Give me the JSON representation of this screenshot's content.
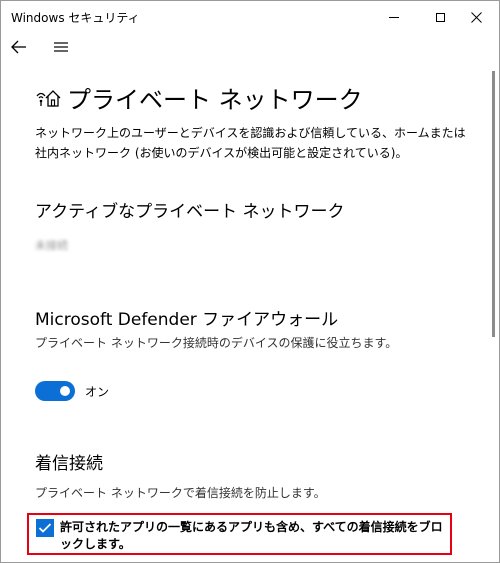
{
  "window": {
    "title": "Windows セキュリティ"
  },
  "page": {
    "title": "プライベート ネットワーク",
    "description": "ネットワーク上のユーザーとデバイスを認識および信頼している、ホームまたは社内ネットワーク (お使いのデバイスが検出可能と設定されている)。"
  },
  "active_networks": {
    "heading": "アクティブなプライベート ネットワーク",
    "network_name": "未接続"
  },
  "firewall": {
    "heading": "Microsoft Defender ファイアウォール",
    "description": "プライベート ネットワーク接続時のデバイスの保護に役立ちます。",
    "toggle_label": "オン",
    "toggle_on": true
  },
  "incoming": {
    "heading": "着信接続",
    "description": "プライベート ネットワークで着信接続を防止します。",
    "checkbox_label": "許可されたアプリの一覧にあるアプリも含め、すべての着信接続をブロックします。",
    "checkbox_checked": true
  },
  "colors": {
    "accent": "#0b6fd6",
    "highlight_border": "#e60012"
  },
  "icons": {
    "back": "back-arrow-icon",
    "menu": "hamburger-menu-icon",
    "page": "wifi-home-icon",
    "minimize": "minimize-icon",
    "maximize": "maximize-icon",
    "close": "close-icon",
    "check": "checkmark-icon"
  }
}
